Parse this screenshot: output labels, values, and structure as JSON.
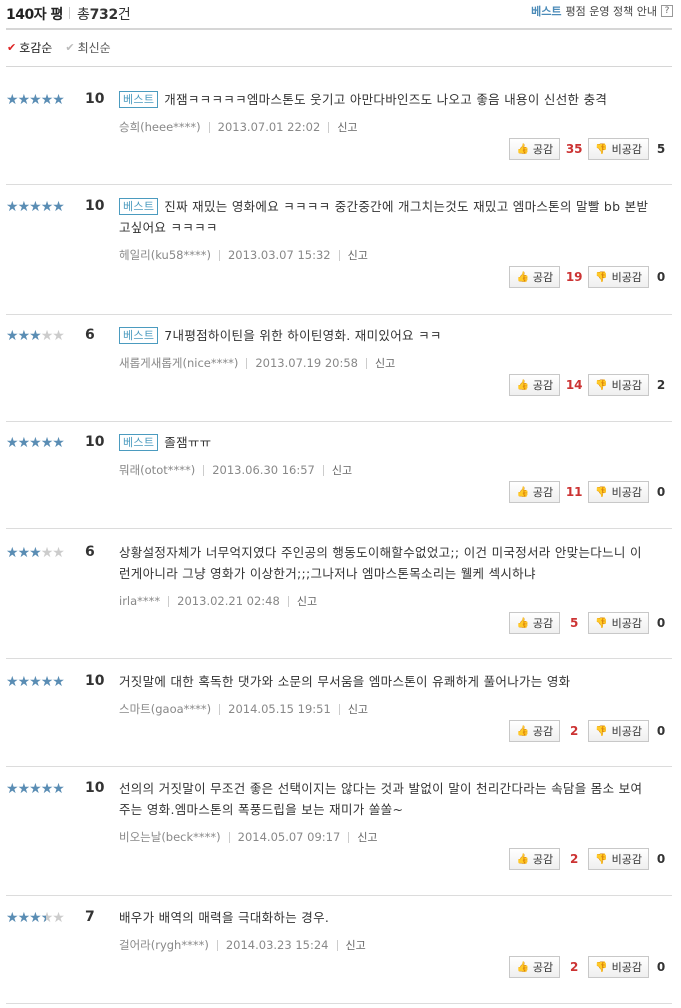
{
  "header": {
    "title": "140자 평",
    "total_prefix": "총",
    "total_count": "732",
    "total_suffix": "건",
    "best_label": "베스트",
    "policy_label": "평점 운영 정책 안내",
    "help_label": "?"
  },
  "sort": {
    "likes": "호감순",
    "latest": "최신순"
  },
  "labels": {
    "best_badge": "베스트",
    "report": "신고",
    "agree": "공감",
    "disagree": "비공감"
  },
  "reviews": [
    {
      "stars": 5,
      "score": "10",
      "best": true,
      "text": "개잼ㅋㅋㅋㅋㅋ엠마스톤도 웃기고 아만다바인즈도 나오고 좋음 내용이 신선한 충격",
      "author": "승희(heee****)",
      "date": "2013.07.01 22:02",
      "agree": "35",
      "disagree": "5"
    },
    {
      "stars": 5,
      "score": "10",
      "best": true,
      "text": "진짜 재밌는 영화에요 ㅋㅋㅋㅋ 중간중간에 개그치는것도 재밌고 엠마스톤의 말빨 bb 본받고싶어요 ㅋㅋㅋㅋ",
      "author": "헤일리(ku58****)",
      "date": "2013.03.07 15:32",
      "agree": "19",
      "disagree": "0"
    },
    {
      "stars": 3,
      "score": "6",
      "best": true,
      "text": "7내평점하이틴을 위한 하이틴영화. 재미있어요 ㅋㅋ",
      "author": "새롭게새롭게(nice****)",
      "date": "2013.07.19 20:58",
      "agree": "14",
      "disagree": "2"
    },
    {
      "stars": 5,
      "score": "10",
      "best": true,
      "text": "졸잼ㅠㅠ",
      "author": "뭐래(otot****)",
      "date": "2013.06.30 16:57",
      "agree": "11",
      "disagree": "0"
    },
    {
      "stars": 3,
      "score": "6",
      "best": false,
      "text": "상황설정자체가 너무억지였다 주인공의 행동도이해할수없었고;; 이건 미국정서라 안맞는다느니 이런게아니라 그냥 영화가 이상한거;;;그나저나 엠마스톤목소리는 웰케 섹시하냐",
      "author": "irla****",
      "date": "2013.02.21 02:48",
      "agree": "5",
      "disagree": "0"
    },
    {
      "stars": 5,
      "score": "10",
      "best": false,
      "text": "거짓말에 대한 혹독한 댓가와 소문의 무서움을 엠마스톤이 유쾌하게 풀어나가는 영화",
      "author": "스마트(gaoa****)",
      "date": "2014.05.15 19:51",
      "agree": "2",
      "disagree": "0"
    },
    {
      "stars": 5,
      "score": "10",
      "best": false,
      "text": "선의의 거짓말이 무조건 좋은 선택이지는 않다는 것과 발없이 말이 천리간다라는 속담을 몸소 보여주는 영화.엠마스톤의 폭풍드립을 보는 재미가 쏠쏠~",
      "author": "비오는날(beck****)",
      "date": "2014.05.07 09:17",
      "agree": "2",
      "disagree": "0"
    },
    {
      "stars": 3.5,
      "score": "7",
      "best": false,
      "text": "배우가 배역의 매력을 극대화하는 경우.",
      "author": "걸어라(rygh****)",
      "date": "2014.03.23 15:24",
      "agree": "2",
      "disagree": "0"
    }
  ],
  "colors": {
    "star_on": "#5a8db4",
    "star_off": "#cccccc",
    "best_badge": "#4b9bbf",
    "agree_count": "#cc3333"
  }
}
